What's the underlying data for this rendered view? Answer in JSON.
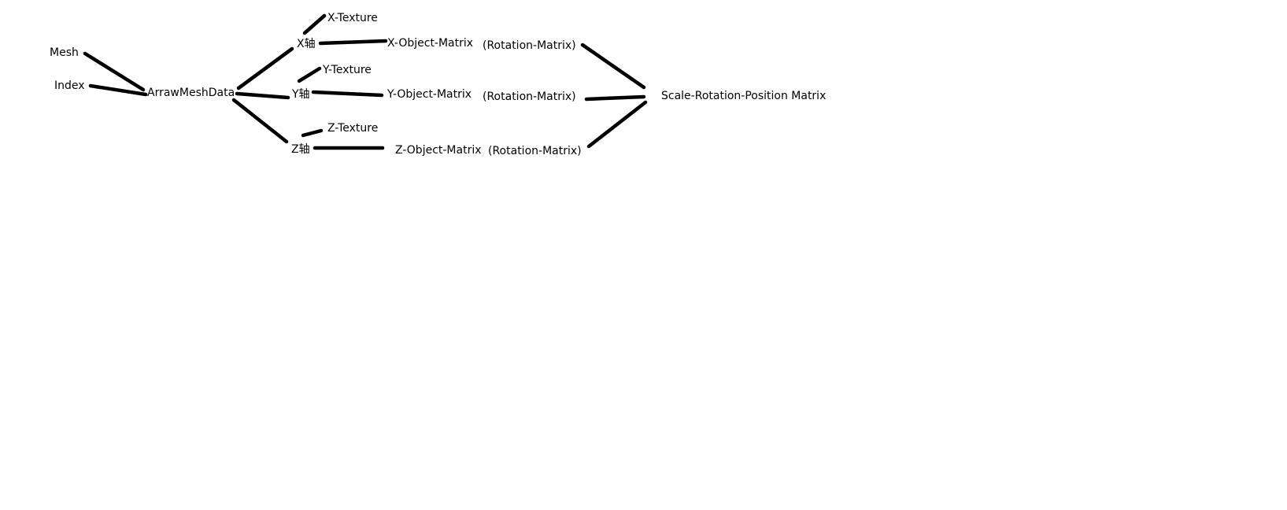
{
  "nodes": {
    "mesh": "Mesh",
    "index": "Index",
    "arraw": "ArrawMeshData",
    "xaxis": "X轴",
    "xtex": "X-Texture",
    "xobj": "X-Object-Matrix",
    "xrot": "(Rotation-Matrix)",
    "yaxis": "Y轴",
    "ytex": "Y-Texture",
    "yobj": "Y-Object-Matrix",
    "yrot": "(Rotation-Matrix)",
    "zaxis": "Z轴",
    "ztex": "Z-Texture",
    "zobj": "Z-Object-Matrix",
    "zrot": "(Rotation-Matrix)",
    "srp": "Scale-Rotation-Position Matrix"
  },
  "edges": [
    [
      "mesh",
      "arraw"
    ],
    [
      "index",
      "arraw"
    ],
    [
      "arraw",
      "xaxis"
    ],
    [
      "arraw",
      "yaxis"
    ],
    [
      "arraw",
      "zaxis"
    ],
    [
      "xaxis",
      "xtex"
    ],
    [
      "xaxis",
      "xobj"
    ],
    [
      "yaxis",
      "ytex"
    ],
    [
      "yaxis",
      "yobj"
    ],
    [
      "zaxis",
      "ztex"
    ],
    [
      "zaxis",
      "zobj"
    ],
    [
      "xrot",
      "srp"
    ],
    [
      "yrot",
      "srp"
    ],
    [
      "zrot",
      "srp"
    ]
  ],
  "colors": {
    "stroke": "#000000",
    "background": "#ffffff"
  }
}
